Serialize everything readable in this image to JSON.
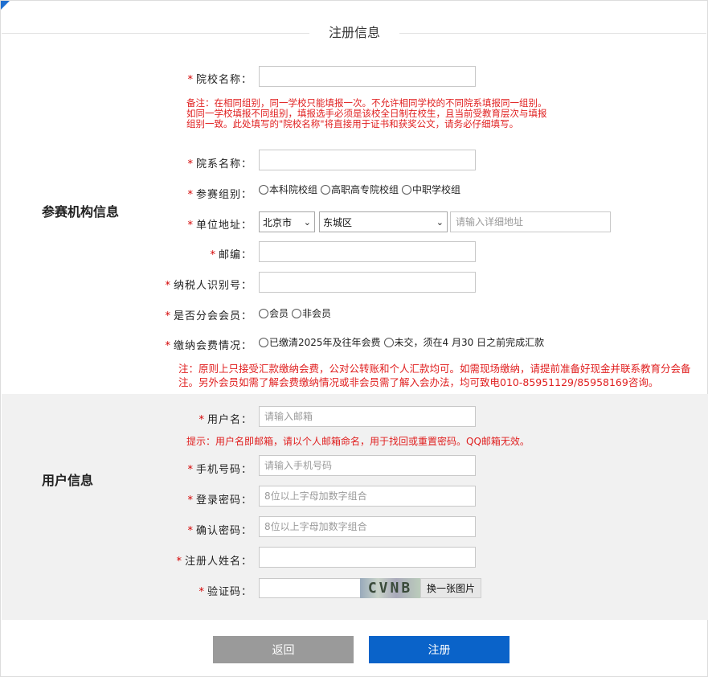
{
  "header": {
    "title": "注册信息"
  },
  "org_section": {
    "label": "参赛机构信息",
    "school_name": {
      "label": "院校名称：",
      "value": "",
      "placeholder": ""
    },
    "school_note": "备注：在相同组别，同一学校只能填报一次。不允许相同学校的不同院系填报同一组别。如同一学校填报不同组别，填报选手必须是该校全日制在校生，且当前受教育层次与填报组别一致。此处填写的\"院校名称\"将直接用于证书和获奖公文，请务必仔细填写。",
    "dept_name": {
      "label": "院系名称：",
      "value": "",
      "placeholder": ""
    },
    "group": {
      "label": "参赛组别：",
      "options": [
        "本科院校组",
        "高职高专院校组",
        "中职学校组"
      ]
    },
    "address": {
      "label": "单位地址：",
      "city": "北京市",
      "district": "东城区",
      "detail_placeholder": "请输入详细地址"
    },
    "postcode": {
      "label": "邮编：",
      "value": ""
    },
    "tax_id": {
      "label": "纳税人识别号：",
      "value": ""
    },
    "member": {
      "label": "是否分会会员：",
      "options": [
        "会员",
        "非会员"
      ]
    },
    "fee": {
      "label": "缴纳会费情况：",
      "options": [
        "已缴清2025年及往年会费",
        "未交，须在4 月30 日之前完成汇款"
      ]
    },
    "fee_note": "注：原则上只接受汇款缴纳会费，公对公转账和个人汇款均可。如需现场缴纳，请提前准备好现金并联系教育分会备注。另外会员如需了解会费缴纳情况或非会员需了解入会办法，均可致电010-85951129/85958169咨询。"
  },
  "user_section": {
    "label": "用户信息",
    "username": {
      "label": "用户名：",
      "placeholder": "请输入邮箱"
    },
    "username_note": "提示：用户名即邮箱，请以个人邮箱命名，用于找回或重置密码。QQ邮箱无效。",
    "phone": {
      "label": "手机号码：",
      "placeholder": "请输入手机号码"
    },
    "password": {
      "label": "登录密码：",
      "placeholder": "8位以上字母加数字组合"
    },
    "confirm": {
      "label": "确认密码：",
      "placeholder": "8位以上字母加数字组合"
    },
    "real_name": {
      "label": "注册人姓名：",
      "value": ""
    },
    "captcha": {
      "label": "验证码：",
      "code": "CVNB",
      "refresh_label": "换一张图片"
    }
  },
  "actions": {
    "back_label": "返回",
    "register_label": "注册"
  },
  "colors": {
    "accent": "#0a63c9",
    "required": "#d40000",
    "note": "#e02020",
    "back": "#9a9a9a"
  }
}
